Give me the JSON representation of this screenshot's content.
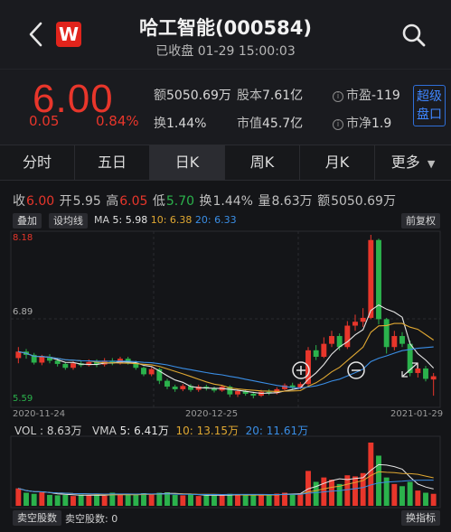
{
  "header": {
    "title": "哈工智能(000584)",
    "subtitle": "已收盘 01-29 15:00:03"
  },
  "quote": {
    "price": "6.00",
    "change": "0.05",
    "change_pct": "0.84%",
    "amount_label": "额",
    "amount": "5050.69万",
    "share_label": "股本",
    "share": "7.61亿",
    "pe_label": "市盈",
    "pe": "-119",
    "turnover_label": "换",
    "turnover": "1.44%",
    "mcap_label": "市值",
    "mcap": "45.7亿",
    "pb_label": "市净",
    "pb": "1.9",
    "super_button": [
      "超级",
      "盘口"
    ]
  },
  "tabs": [
    {
      "label": "分时",
      "active": false
    },
    {
      "label": "五日",
      "active": false
    },
    {
      "label": "日K",
      "active": true
    },
    {
      "label": "周K",
      "active": false
    },
    {
      "label": "月K",
      "active": false
    },
    {
      "label": "更多",
      "active": false
    }
  ],
  "kline_info": {
    "close_label": "收",
    "close": "6.00",
    "open_label": "开",
    "open": "5.95",
    "high_label": "高",
    "high": "6.05",
    "low_label": "低",
    "low": "5.70",
    "turn_label": "换",
    "turn": "1.44%",
    "vol_label": "量",
    "vol": "8.63万",
    "amt_label": "额",
    "amt": "5050.69万"
  },
  "toolbar": {
    "overlay": "叠加",
    "drawline": "设均线",
    "ma_label": "MA",
    "ma5": "5: 5.98",
    "ma10": "10: 6.38",
    "ma20": "20: 6.33",
    "adjust": "前复权"
  },
  "axis": {
    "ymax": "8.18",
    "ymid": "6.89",
    "ymin": "5.59",
    "d1": "2020-11-24",
    "d2": "2020-12-25",
    "d3": "2021-01-29"
  },
  "volume": {
    "vol_label": "VOL :",
    "vol": "8.63万",
    "vma_label": "VMA",
    "vma5": "5: 6.41万",
    "vma10": "10: 13.15万",
    "vma20": "20: 11.61万"
  },
  "bottom": {
    "sell_short": "卖空股数",
    "sell_short_val": "卖空股数: 0",
    "indicator": "换指标"
  },
  "colors": {
    "up": "#e8362b",
    "down": "#2bb24c",
    "ma5": "#e6e6e6",
    "ma10": "#e0a832",
    "ma20": "#3a8ee6"
  },
  "chart_data": {
    "type": "candlestick",
    "ylim": [
      5.59,
      8.18
    ],
    "x_tick_labels": [
      "2020-11-24",
      "2020-12-25",
      "2021-01-29"
    ],
    "candles": [
      [
        6.28,
        6.38,
        6.45,
        6.2
      ],
      [
        6.38,
        6.33,
        6.42,
        6.27
      ],
      [
        6.33,
        6.21,
        6.36,
        6.18
      ],
      [
        6.21,
        6.3,
        6.33,
        6.17
      ],
      [
        6.3,
        6.24,
        6.34,
        6.2
      ],
      [
        6.24,
        6.19,
        6.27,
        6.15
      ],
      [
        6.19,
        6.13,
        6.22,
        6.1
      ],
      [
        6.13,
        6.2,
        6.23,
        6.1
      ],
      [
        6.2,
        6.17,
        6.24,
        6.14
      ],
      [
        6.17,
        6.22,
        6.26,
        6.15
      ],
      [
        6.22,
        6.18,
        6.26,
        6.14
      ],
      [
        6.18,
        6.24,
        6.28,
        6.15
      ],
      [
        6.24,
        6.2,
        6.28,
        6.17
      ],
      [
        6.2,
        6.27,
        6.3,
        6.18
      ],
      [
        6.27,
        6.21,
        6.3,
        6.18
      ],
      [
        6.21,
        6.13,
        6.24,
        6.1
      ],
      [
        6.13,
        6.03,
        6.15,
        6.0
      ],
      [
        6.03,
        6.11,
        6.14,
        6.0
      ],
      [
        6.11,
        5.93,
        6.13,
        5.88
      ],
      [
        5.93,
        5.84,
        5.96,
        5.8
      ],
      [
        5.84,
        5.8,
        5.87,
        5.76
      ],
      [
        5.8,
        5.85,
        5.88,
        5.77
      ],
      [
        5.85,
        5.79,
        5.88,
        5.76
      ],
      [
        5.79,
        5.84,
        5.87,
        5.76
      ],
      [
        5.84,
        5.81,
        5.87,
        5.78
      ],
      [
        5.81,
        5.78,
        5.84,
        5.75
      ],
      [
        5.78,
        5.84,
        5.87,
        5.76
      ],
      [
        5.84,
        5.72,
        5.86,
        5.68
      ],
      [
        5.72,
        5.77,
        5.8,
        5.68
      ],
      [
        5.77,
        5.73,
        5.8,
        5.7
      ],
      [
        5.73,
        5.7,
        5.76,
        5.66
      ],
      [
        5.7,
        5.76,
        5.79,
        5.68
      ],
      [
        5.76,
        5.74,
        5.8,
        5.71
      ],
      [
        5.74,
        5.8,
        5.83,
        5.72
      ],
      [
        5.8,
        5.86,
        5.89,
        5.78
      ],
      [
        5.86,
        5.82,
        5.9,
        5.79
      ],
      [
        5.82,
        5.88,
        5.91,
        5.8
      ],
      [
        5.88,
        6.4,
        6.45,
        5.86
      ],
      [
        6.4,
        6.3,
        6.48,
        6.25
      ],
      [
        6.3,
        6.5,
        6.6,
        6.28
      ],
      [
        6.5,
        6.62,
        6.7,
        6.45
      ],
      [
        6.62,
        6.45,
        6.66,
        6.4
      ],
      [
        6.45,
        6.78,
        6.85,
        6.42
      ],
      [
        6.78,
        6.84,
        6.95,
        6.7
      ],
      [
        6.84,
        6.9,
        7.05,
        6.76
      ],
      [
        6.9,
        8.1,
        8.18,
        6.88
      ],
      [
        8.1,
        6.88,
        8.12,
        6.8
      ],
      [
        6.88,
        6.45,
        6.9,
        6.35
      ],
      [
        6.45,
        6.62,
        6.7,
        6.4
      ],
      [
        6.62,
        6.5,
        6.68,
        6.45
      ],
      [
        6.5,
        6.05,
        6.55,
        6.0
      ],
      [
        6.05,
        6.12,
        6.2,
        5.98
      ],
      [
        6.12,
        5.96,
        6.16,
        5.92
      ],
      [
        5.95,
        6.0,
        6.05,
        5.7
      ]
    ],
    "volumes": [
      0.8,
      0.6,
      0.55,
      0.62,
      0.5,
      0.48,
      0.5,
      0.45,
      0.52,
      0.48,
      0.5,
      0.46,
      0.6,
      0.55,
      0.52,
      0.5,
      0.58,
      0.54,
      0.6,
      0.62,
      0.5,
      0.48,
      0.52,
      0.45,
      0.5,
      0.47,
      0.5,
      0.55,
      0.5,
      0.48,
      0.5,
      0.52,
      0.48,
      0.56,
      0.6,
      0.55,
      0.58,
      1.6,
      1.1,
      1.3,
      1.2,
      1.0,
      1.4,
      1.35,
      1.5,
      2.9,
      2.3,
      1.3,
      1.0,
      0.9,
      1.1,
      0.7,
      0.6,
      0.55
    ]
  }
}
